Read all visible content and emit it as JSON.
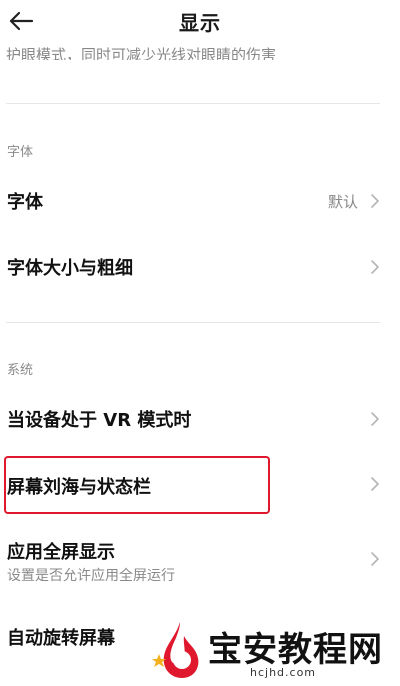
{
  "header": {
    "title": "显示"
  },
  "top_partial_text": "护眼模式，同时可减少光线对眼睛的伤害",
  "sections": {
    "font": {
      "label": "字体",
      "items": {
        "font": {
          "label": "字体",
          "value": "默认"
        },
        "font_size": {
          "label": "字体大小与粗细"
        }
      }
    },
    "system": {
      "label": "系统",
      "items": {
        "vr_mode": {
          "label": "当设备处于 VR 模式时"
        },
        "notch_status_bar": {
          "label": "屏幕刘海与状态栏"
        },
        "fullscreen_apps": {
          "label": "应用全屏显示",
          "subtitle": "设置是否允许应用全屏运行"
        },
        "auto_rotate": {
          "label": "自动旋转屏幕"
        }
      }
    }
  },
  "watermark": {
    "text": "宝安教程网",
    "url": "hcjhd.com"
  },
  "colors": {
    "highlight": "#e0182d",
    "watermark_red": "#e0182d"
  },
  "icons": {
    "back": "arrow-left-icon",
    "chevron": "chevron-right-icon"
  }
}
